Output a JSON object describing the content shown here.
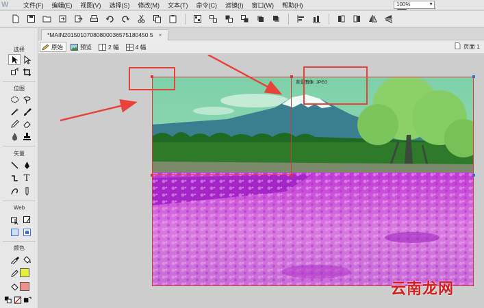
{
  "app": {
    "logo": "W"
  },
  "menu": {
    "items": [
      "文件(F)",
      "编辑(E)",
      "视图(V)",
      "选择(S)",
      "修改(M)",
      "文本(T)",
      "命令(C)",
      "滤镜(I)",
      "窗口(W)",
      "帮助(H)"
    ]
  },
  "menubar_right": {
    "bridge_label": "Br",
    "zoom_value": "100%"
  },
  "document": {
    "tab_title": "*MAIN20150107080800036575180450 5",
    "close_glyph": "×"
  },
  "viewbar": {
    "original_label": "原始",
    "preview_label": "预览",
    "two_up_label": "2 幅",
    "four_up_label": "4 幅",
    "page_label": "页面 1"
  },
  "tools": {
    "select_label": "选择",
    "bitmap_label": "位图",
    "vector_label": "矢量",
    "web_label": "Web",
    "color_label": "颜色",
    "text_tool_glyph": "T"
  },
  "canvas": {
    "photo_label": "背景图像: JPEG",
    "watermark": "云南龙网"
  },
  "colors": {
    "annotation": "#e8433a",
    "slice": "#d23a3a",
    "handle_blue": "#3a6ed2",
    "fill_swatch": "#e6f03a",
    "stroke_swatch": "#f08f8f"
  }
}
